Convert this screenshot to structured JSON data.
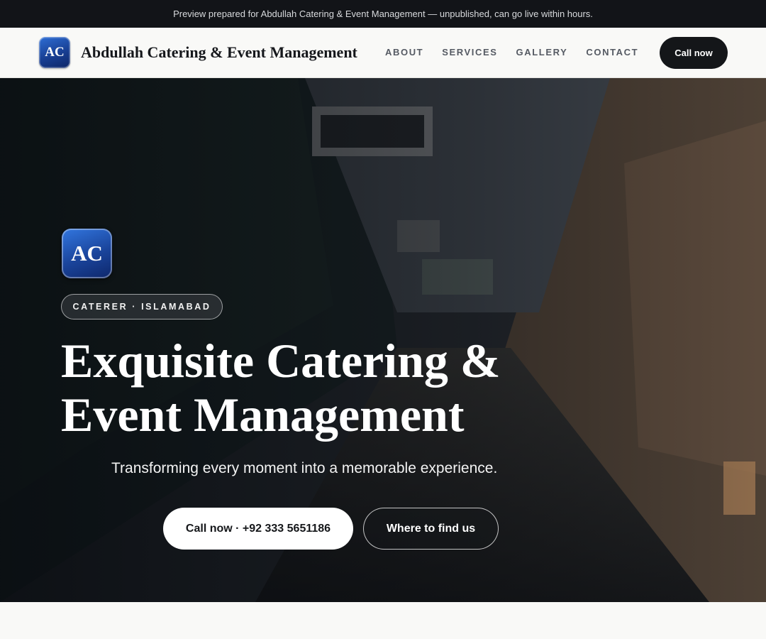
{
  "preview_banner": "Preview prepared for Abdullah Catering & Event Management — unpublished, can go live within hours.",
  "header": {
    "logo_initials": "AC",
    "brand_name": "Abdullah Catering & Event Management",
    "nav": [
      "ABOUT",
      "SERVICES",
      "GALLERY",
      "CONTACT"
    ],
    "cta_label": "Call now"
  },
  "hero": {
    "logo_initials": "AC",
    "tag": "CATERER · ISLAMABAD",
    "title_line1": "Exquisite Catering &",
    "title_line2": "Event Management",
    "subtitle": "Transforming every moment into a memorable experience.",
    "primary_button": "Call now · +92 333 5651186",
    "secondary_button": "Where to find us"
  },
  "colors": {
    "dark": "#141619",
    "logo_blue": "#1a449b",
    "page_bg": "#f9f9f7"
  }
}
